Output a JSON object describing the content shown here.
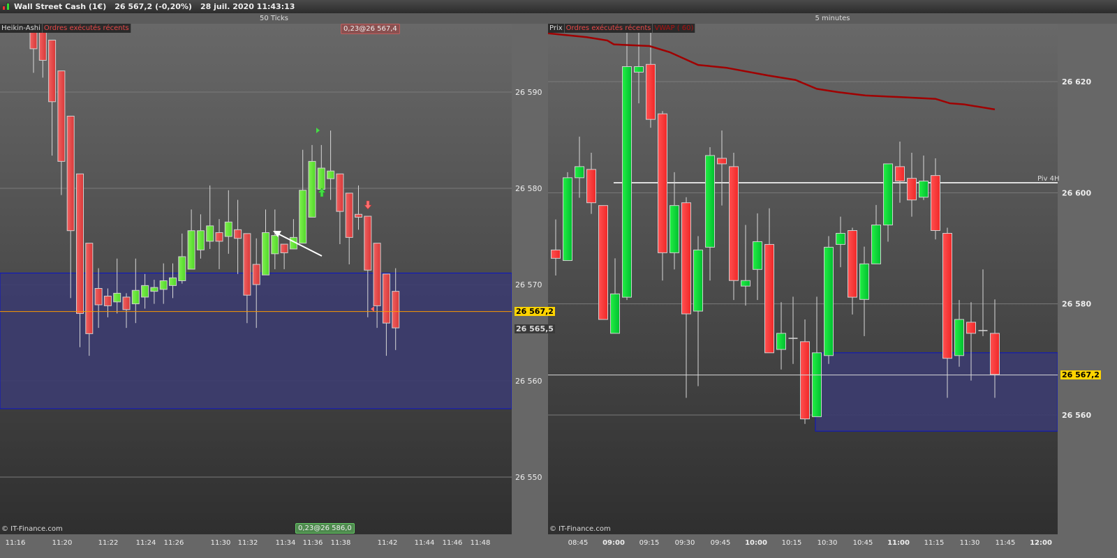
{
  "window": {
    "title": "Wall Street Cash (1€)",
    "price": "26 567,2",
    "change": "(-0,20%)",
    "datetime": "28 juil. 2020 11:43:13"
  },
  "left": {
    "header": "50 Ticks",
    "tags": [
      "Heikin-Ashi",
      "Ordres exécutés récents"
    ],
    "order_top": "0,23@26 567,4",
    "order_bottom": "0,23@26 586,0",
    "watermark": "© IT-Finance.com",
    "price_badge": "26 567,2",
    "price_badge2": "26 565,5"
  },
  "right": {
    "header": "5 minutes",
    "tags": [
      "Prix",
      "Ordres exécutés récents",
      "VWAP ( 60)"
    ],
    "pivot_label": "Piv 4H",
    "watermark": "© IT-Finance.com",
    "price_badge": "26 567,2"
  },
  "colors": {
    "up": "#2ee03a",
    "up_ha": "#6aee3c",
    "down": "#f04545",
    "zone": "#3c3c6e",
    "zone_border": "#0a14c8",
    "last_price": "#ff9900",
    "vwap": "#a00000",
    "badge": "#ffd400"
  },
  "chart_data": [
    {
      "type": "candlestick",
      "title": "50 Ticks",
      "style": "Heikin-Ashi",
      "ylim": [
        26546,
        26598
      ],
      "yticks": [
        26590,
        26580,
        26570,
        26560,
        26550
      ],
      "ytick_labels": [
        "26 590",
        "26 580",
        "26 570",
        "26 560",
        "26 550"
      ],
      "xtick_labels": [
        "11:16",
        "11:20",
        "11:22",
        "11:24",
        "11:26",
        "11:30",
        "11:32",
        "11:34",
        "11:36",
        "11:38",
        "11:42",
        "11:44",
        "11:46",
        "11:48"
      ],
      "zone": [
        26557.1,
        26571.2
      ],
      "last_price": 26567.2,
      "ohlc": [
        [
          26596.7,
          26597.5,
          26592.0,
          26594.5
        ],
        [
          26596.7,
          26597.5,
          26591.5,
          26593.3
        ],
        [
          26595.4,
          26595.4,
          26583.4,
          26589.0
        ],
        [
          26592.2,
          26592.2,
          26579.3,
          26582.8
        ],
        [
          26587.5,
          26587.5,
          26568.6,
          26575.6
        ],
        [
          26581.5,
          26581.5,
          26563.5,
          26567.0
        ],
        [
          26574.3,
          26574.3,
          26562.6,
          26564.9
        ],
        [
          26569.6,
          26571.7,
          26565.5,
          26567.9
        ],
        [
          26568.8,
          26569.6,
          26566.6,
          26567.8
        ],
        [
          26568.2,
          26572.7,
          26567.0,
          26569.1
        ],
        [
          26568.7,
          26569.1,
          26565.5,
          26567.4
        ],
        [
          26568.0,
          26572.7,
          26566.0,
          26569.4
        ],
        [
          26568.7,
          26571.1,
          26567.5,
          26569.9
        ],
        [
          26569.3,
          26570.5,
          26568.0,
          26569.7
        ],
        [
          26569.5,
          26572.2,
          26568.0,
          26570.4
        ],
        [
          26569.9,
          26572.2,
          26568.6,
          26570.7
        ],
        [
          26570.4,
          26575.3,
          26570.1,
          26572.9
        ],
        [
          26571.6,
          26577.8,
          26571.6,
          26575.6
        ],
        [
          26573.6,
          26577.3,
          26572.7,
          26575.6
        ],
        [
          26574.5,
          26580.3,
          26573.7,
          26576.1
        ],
        [
          26575.4,
          26576.8,
          26571.6,
          26574.5
        ],
        [
          26575.0,
          26579.8,
          26573.2,
          26576.5
        ],
        [
          26575.7,
          26578.8,
          26571.1,
          26574.8
        ],
        [
          26575.3,
          26575.3,
          26566.0,
          26568.9
        ],
        [
          26572.1,
          26574.8,
          26565.5,
          26570.0
        ],
        [
          26571.0,
          26577.8,
          26571.0,
          26575.4
        ],
        [
          26573.2,
          26577.8,
          26571.6,
          26575.1
        ],
        [
          26574.2,
          26574.2,
          26571.6,
          26573.3
        ],
        [
          26573.7,
          26576.8,
          26573.7,
          26574.9
        ],
        [
          26574.3,
          26584.0,
          26574.3,
          26579.8
        ],
        [
          26577.0,
          26584.5,
          26577.0,
          26582.8
        ],
        [
          26579.9,
          26584.5,
          26579.9,
          26582.1
        ],
        [
          26581.0,
          26586.0,
          26578.8,
          26581.8
        ],
        [
          26581.5,
          26581.5,
          26574.2,
          26577.6
        ],
        [
          26579.5,
          26579.5,
          26572.1,
          26574.9
        ],
        [
          26577.3,
          26580.3,
          26575.7,
          26577.0
        ],
        [
          26577.1,
          26577.1,
          26566.6,
          26571.5
        ],
        [
          26574.3,
          26574.3,
          26565.5,
          26567.8
        ],
        [
          26571.1,
          26571.1,
          26562.6,
          26566.0
        ],
        [
          26569.3,
          26571.7,
          26563.2,
          26565.5
        ]
      ]
    },
    {
      "type": "candlestick",
      "title": "5 minutes",
      "style": "Prix",
      "ylim": [
        26541,
        26630
      ],
      "yticks": [
        26620,
        26600,
        26580,
        26560
      ],
      "ytick_labels": [
        "26 620",
        "26 600",
        "26 580",
        "26 560"
      ],
      "xtick_labels": [
        "08:45",
        "09:00",
        "09:15",
        "09:30",
        "09:45",
        "10:00",
        "10:15",
        "10:30",
        "10:45",
        "11:00",
        "11:15",
        "11:30",
        "11:45",
        "12:00"
      ],
      "zone": [
        26557.1,
        26571.2
      ],
      "last_price": 26567.2,
      "pivot": 26601.8,
      "vwap": [
        [
          -0.65,
          26628.7
        ],
        [
          2.6,
          26628.0
        ],
        [
          4.35,
          26627.4
        ],
        [
          4.9,
          26626.7
        ],
        [
          7.9,
          26626.4
        ],
        [
          9.6,
          26625.3
        ],
        [
          12,
          26623.0
        ],
        [
          14.35,
          26622.5
        ],
        [
          17.9,
          26621.1
        ],
        [
          20.2,
          26620.3
        ],
        [
          22,
          26618.7
        ],
        [
          23.8,
          26618.1
        ],
        [
          26.1,
          26617.5
        ],
        [
          29.1,
          26617.2
        ],
        [
          32,
          26616.9
        ],
        [
          33.2,
          26616.1
        ],
        [
          34.4,
          26615.9
        ],
        [
          37,
          26615.0
        ]
      ],
      "ohlc": [
        [
          26589.7,
          26595.2,
          26585.1,
          26588.2
        ],
        [
          26587.8,
          26603.7,
          26587.8,
          26602.7
        ],
        [
          26602.7,
          26610.1,
          26599.1,
          26604.7
        ],
        [
          26604.2,
          26607.2,
          26596.2,
          26598.2
        ],
        [
          26597.7,
          26597.7,
          26577.2,
          26577.2
        ],
        [
          26574.7,
          26588.2,
          26574.7,
          26581.8
        ],
        [
          26581.2,
          26628.8,
          26580.7,
          26622.7
        ],
        [
          26621.7,
          26628.8,
          26616.1,
          26622.7
        ],
        [
          26623.1,
          26628.8,
          26611.7,
          26613.2
        ],
        [
          26614.2,
          26614.7,
          26584.2,
          26589.2
        ],
        [
          26589.2,
          26603.7,
          26586.2,
          26597.7
        ],
        [
          26598.2,
          26599.2,
          26563.1,
          26578.2
        ],
        [
          26578.7,
          26592.2,
          26565.2,
          26589.7
        ],
        [
          26590.2,
          26608.2,
          26584.2,
          26606.7
        ],
        [
          26606.2,
          26611.2,
          26597.7,
          26605.2
        ],
        [
          26604.7,
          26607.2,
          26580.7,
          26584.2
        ],
        [
          26583.2,
          26594.2,
          26579.7,
          26584.2
        ],
        [
          26586.2,
          26596.3,
          26580.7,
          26591.2
        ],
        [
          26590.7,
          26597.2,
          26571.2,
          26571.2
        ],
        [
          26571.8,
          26580.3,
          26568.2,
          26574.7
        ],
        [
          26573.8,
          26581.3,
          26569.2,
          26573.8
        ],
        [
          26573.2,
          26577.2,
          26558.4,
          26559.3
        ],
        [
          26559.7,
          26581.3,
          26559.7,
          26571.2
        ],
        [
          26570.7,
          26592.2,
          26569.2,
          26590.2
        ],
        [
          26590.7,
          26595.7,
          26586.6,
          26592.7
        ],
        [
          26593.2,
          26593.7,
          26578.1,
          26581.2
        ],
        [
          26580.8,
          26590.3,
          26574.2,
          26587.2
        ],
        [
          26587.2,
          26597.8,
          26587.2,
          26594.2
        ],
        [
          26594.2,
          26605.2,
          26591.2,
          26605.2
        ],
        [
          26604.7,
          26609.2,
          26598.2,
          26602.1
        ],
        [
          26602.6,
          26607.2,
          26595.7,
          26598.7
        ],
        [
          26599.2,
          26606.7,
          26598.7,
          26602.1
        ],
        [
          26603.1,
          26606.2,
          26591.6,
          26593.2
        ],
        [
          26592.7,
          26593.7,
          26563.1,
          26570.2
        ],
        [
          26570.7,
          26580.7,
          26568.7,
          26577.2
        ],
        [
          26576.7,
          26580.3,
          26566.2,
          26574.7
        ],
        [
          26575.2,
          26586.2,
          26574.2,
          26575.2
        ],
        [
          26574.7,
          26580.8,
          26563.1,
          26567.3
        ]
      ]
    }
  ]
}
